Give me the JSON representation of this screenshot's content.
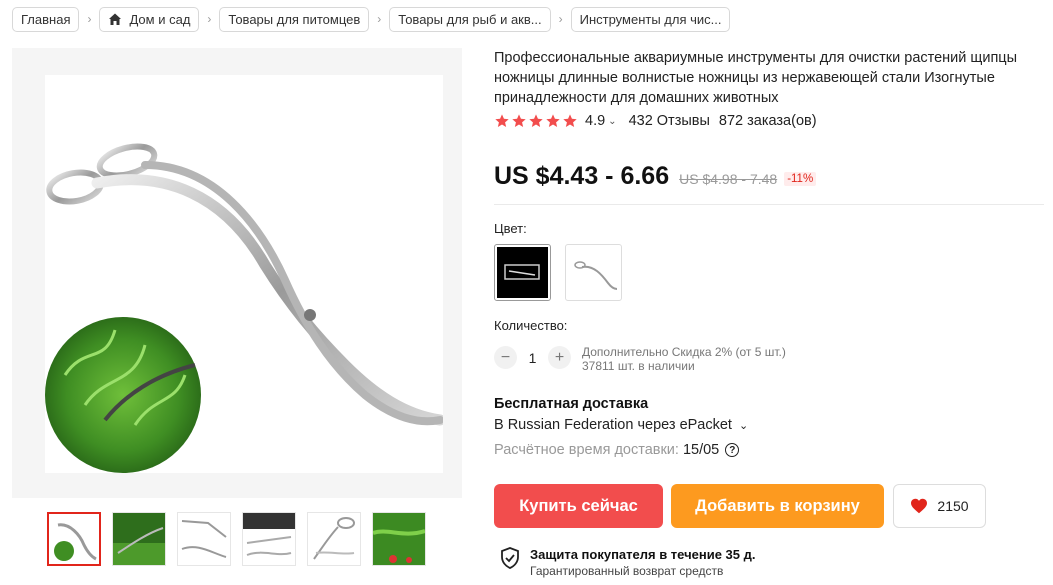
{
  "breadcrumb": [
    {
      "label": "Главная"
    },
    {
      "label": "Дом и сад",
      "icon": "home-icon"
    },
    {
      "label": "Товары для питомцев"
    },
    {
      "label": "Товары для рыб и акв..."
    },
    {
      "label": "Инструменты для чис..."
    }
  ],
  "product": {
    "title": "Профессиональные аквариумные инструменты для очистки растений щипцы ножницы длинные волнистые ножницы из нержавеющей стали Изогнутые принадлежности для домашних животных",
    "rating": "4.9",
    "reviews": "432 Отзывы",
    "orders": "872 заказа(ов)",
    "price": "US $4.43 - 6.66",
    "old_price": "US $4.98 - 7.48",
    "discount": "-11%"
  },
  "options": {
    "color_label": "Цвет:",
    "quantity_label": "Количество:",
    "quantity_value": "1",
    "discount_note": "Дополнительно Скидка 2% (от 5 шт.)",
    "stock": "37811 шт. в наличии"
  },
  "shipping": {
    "title": "Бесплатная доставка",
    "route": "В Russian Federation через ePacket",
    "estimate_label": "Расчётное время доставки:",
    "estimate_value": "15/05"
  },
  "actions": {
    "buy": "Купить сейчас",
    "cart": "Добавить в корзину",
    "wishlist_count": "2150"
  },
  "protection": {
    "title": "Защита покупателя в течение 35 д.",
    "subtitle": "Гарантированный возврат средств"
  },
  "colors": {
    "star": "#f24d4d",
    "buy_button": "#f24d4d",
    "cart_button": "#fd9a1f",
    "discount": "#e1251b"
  }
}
